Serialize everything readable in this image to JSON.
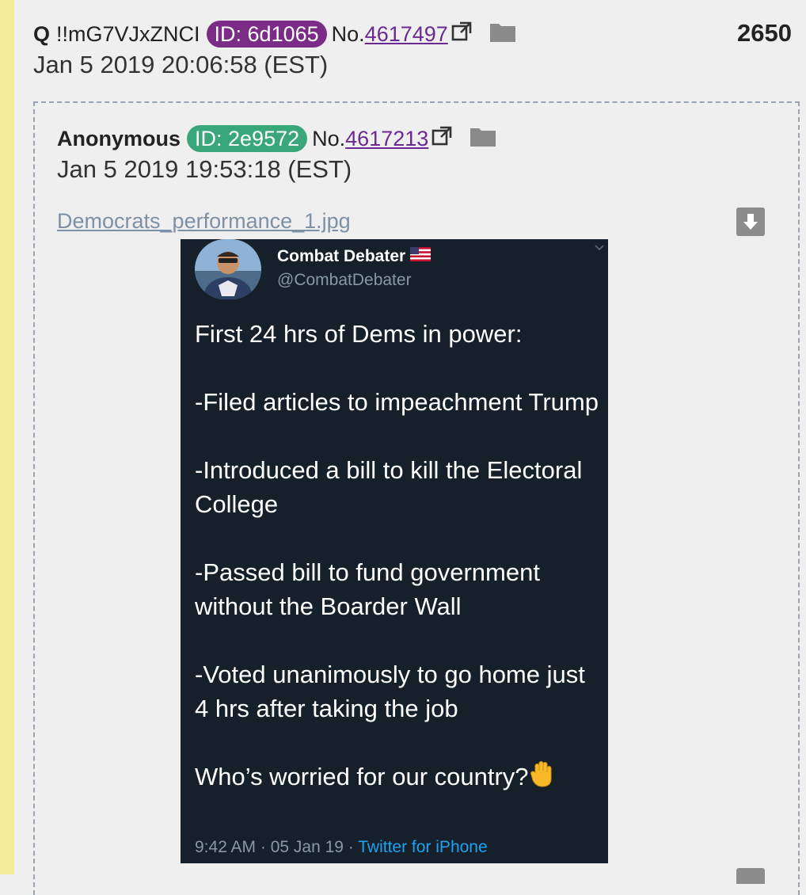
{
  "q_post": {
    "name": "Q",
    "tripcode": "!!mG7VJxZNCI",
    "id_label": "ID: 6d1065",
    "no_prefix": "No.",
    "no": "4617497",
    "date": "Jan 5 2019 20:06:58 (EST)",
    "post_counter": "2650"
  },
  "reply_post": {
    "name": "Anonymous",
    "id_label": "ID: 2e9572",
    "no_prefix": "No.",
    "no": "4617213",
    "date": "Jan 5 2019 19:53:18 (EST)",
    "filename": "Democrats_performance_1.jpg"
  },
  "tweet": {
    "display_name": "Combat Debater",
    "handle": "@CombatDebater",
    "lines": [
      "First 24 hrs of Dems in power:",
      "-Filed articles to impeachment Trump",
      "-Introduced a bill to kill the Electoral College",
      "-Passed bill to fund government without the Boarder Wall",
      "-Voted unanimously to go home just 4 hrs after taking the job",
      "Who’s worried for our country?"
    ],
    "time": "9:42 AM · 05 Jan 19 · ",
    "source": "Twitter for iPhone"
  },
  "colors": {
    "q_id_pill": "#7b2c86",
    "anon_id_pill": "#3aa77a",
    "link": "#6b2a93",
    "tweet_bg": "#15202b",
    "twitter_blue": "#1da1f2"
  },
  "icons": [
    "external-link-icon",
    "folder-icon",
    "download-icon",
    "us-flag-icon",
    "raised-hand-icon",
    "chevron-down-icon"
  ]
}
